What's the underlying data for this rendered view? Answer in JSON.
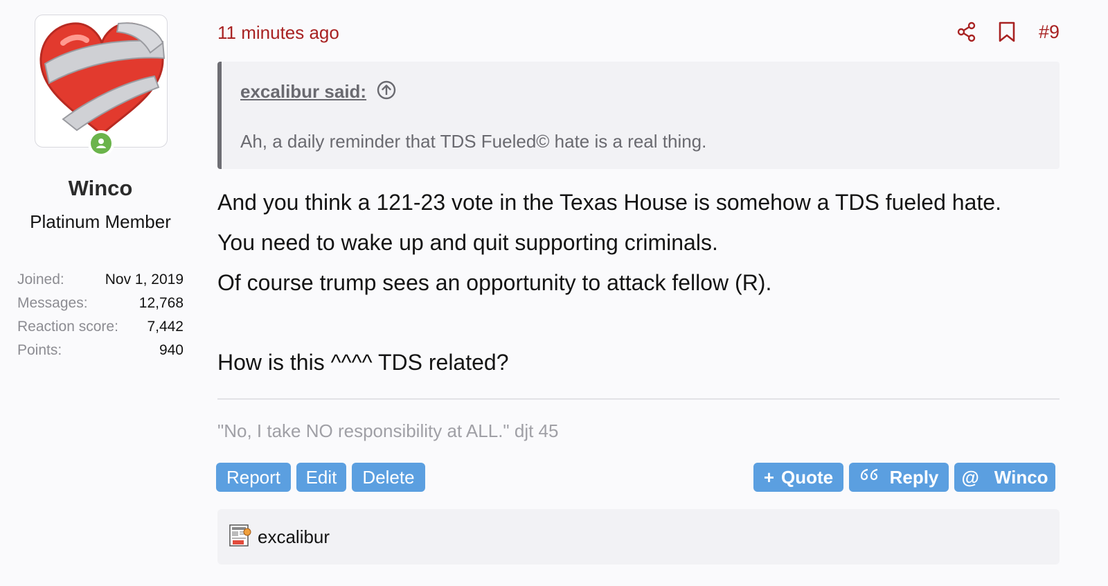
{
  "user": {
    "name": "Winco",
    "title": "Platinum Member",
    "stats": [
      {
        "label": "Joined:",
        "value": "Nov 1, 2019"
      },
      {
        "label": "Messages:",
        "value": "12,768"
      },
      {
        "label": "Reaction score:",
        "value": "7,442"
      },
      {
        "label": "Points:",
        "value": "940"
      }
    ],
    "online_icon": "user-online-icon"
  },
  "post": {
    "time": "11 minutes ago",
    "number": "#9",
    "share_icon": "share-icon",
    "bookmark_icon": "bookmark-icon",
    "quote": {
      "author": "excalibur said:",
      "jump_icon": "arrow-up-circle-icon",
      "text": "Ah, a daily reminder that TDS Fueled© hate is a real thing."
    },
    "body": {
      "line1": "And you think a 121-23 vote in the Texas House is somehow a TDS fueled hate.",
      "line2": "You need to wake up and quit supporting criminals.",
      "line3": "Of course trump sees an opportunity to attack fellow (R).",
      "line4": "How is this ^^^^ TDS related?"
    },
    "signature": "\"No, I take NO responsibility at ALL.\" djt 45",
    "actions": {
      "report": "Report",
      "edit": "Edit",
      "delete": "Delete",
      "quote_symbol": "+",
      "quote": "Quote",
      "reply": "Reply",
      "mention_symbol": "@",
      "mention": "Winco"
    },
    "reactions": {
      "icon": "fake-news-reaction-icon",
      "reactor": "excalibur"
    }
  },
  "colors": {
    "accent": "#a82222",
    "button": "#5b9fe0",
    "online": "#6bb44b"
  }
}
